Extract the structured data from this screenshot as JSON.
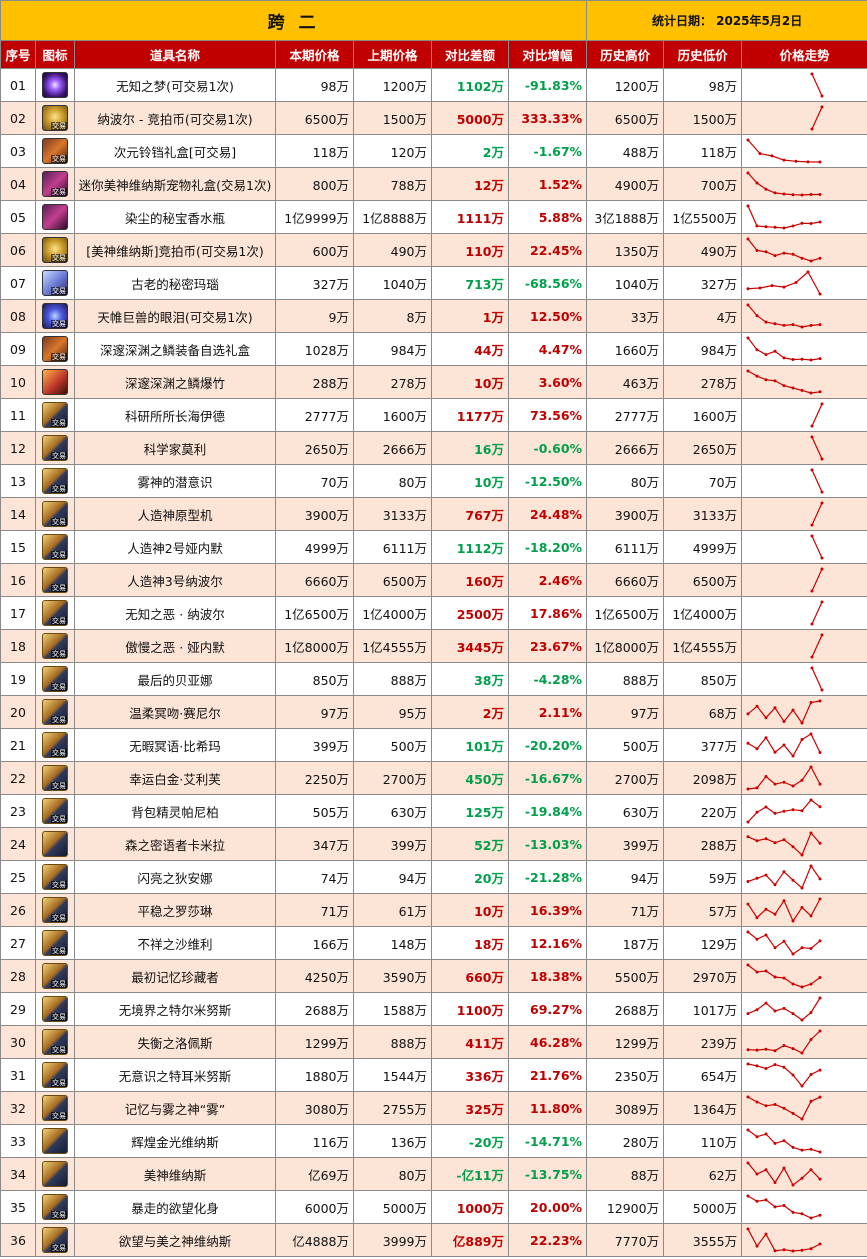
{
  "title": "跨  二",
  "stat_date": "统计日期：  2025年5月2日",
  "columns": {
    "idx": "序号",
    "icon": "图标",
    "name": "道具名称",
    "cur": "本期价格",
    "prev": "上期价格",
    "diff": "对比差额",
    "pct": "对比增幅",
    "high": "历史高价",
    "low": "历史低价",
    "trend": "价格走势"
  },
  "colors": {
    "title_bg": "#ffc000",
    "header_bg": "#c00000",
    "even_row": "#fce4d6",
    "up": "#c00000",
    "down": "#00a04a",
    "trend_line": "#cc0000"
  },
  "rows": [
    {
      "idx": "01",
      "icon": "orb",
      "trade": false,
      "name": "无知之梦(可交易1次)",
      "cur": "98万",
      "prev": "1200万",
      "diff": "1102万",
      "pct": "-91.83%",
      "dir": "down",
      "high": "1200万",
      "low": "98万",
      "trend": [
        1200,
        98
      ]
    },
    {
      "idx": "02",
      "icon": "coin",
      "trade": true,
      "name": "纳波尔 - 竞拍币(可交易1次)",
      "cur": "6500万",
      "prev": "1500万",
      "diff": "5000万",
      "pct": "333.33%",
      "dir": "up",
      "high": "6500万",
      "low": "1500万",
      "trend": [
        1500,
        6500
      ]
    },
    {
      "idx": "03",
      "icon": "box",
      "trade": true,
      "name": "次元铃铛礼盒[可交易]",
      "cur": "118万",
      "prev": "120万",
      "diff": "2万",
      "pct": "-1.67%",
      "dir": "down",
      "high": "488万",
      "low": "118万",
      "trend": [
        488,
        260,
        220,
        150,
        130,
        120,
        118
      ]
    },
    {
      "idx": "04",
      "icon": "bag",
      "trade": true,
      "name": "迷你美神维纳斯宠物礼盒(交易1次)",
      "cur": "800万",
      "prev": "788万",
      "diff": "12万",
      "pct": "1.52%",
      "dir": "up",
      "high": "4900万",
      "low": "700万",
      "trend": [
        4900,
        3000,
        1800,
        1100,
        900,
        760,
        700,
        788,
        800
      ]
    },
    {
      "idx": "05",
      "icon": "bag",
      "trade": false,
      "name": "染尘的秘宝香水瓶",
      "cur": "1亿9999万",
      "prev": "1亿8888万",
      "diff": "1111万",
      "pct": "5.88%",
      "dir": "up",
      "high": "3亿1888万",
      "low": "1亿5500万",
      "trend": [
        31888,
        17000,
        16500,
        16000,
        15500,
        17000,
        19000,
        18888,
        19999
      ]
    },
    {
      "idx": "06",
      "icon": "coin",
      "trade": true,
      "name": "[美神维纳斯]竞拍币(可交易1次)",
      "cur": "600万",
      "prev": "490万",
      "diff": "110万",
      "pct": "22.45%",
      "dir": "up",
      "high": "1350万",
      "low": "490万",
      "trend": [
        1350,
        900,
        850,
        700,
        800,
        750,
        600,
        490,
        600
      ]
    },
    {
      "idx": "07",
      "icon": "crystal",
      "trade": true,
      "name": "古老的秘密玛瑙",
      "cur": "327万",
      "prev": "1040万",
      "diff": "713万",
      "pct": "-68.56%",
      "dir": "down",
      "high": "1040万",
      "low": "327万",
      "trend": [
        500,
        520,
        600,
        550,
        700,
        1040,
        327
      ]
    },
    {
      "idx": "08",
      "icon": "eye",
      "trade": true,
      "name": "天帷巨兽的眼泪(可交易1次)",
      "cur": "9万",
      "prev": "8万",
      "diff": "1万",
      "pct": "12.50%",
      "dir": "up",
      "high": "33万",
      "low": "4万",
      "trend": [
        33,
        20,
        12,
        10,
        8,
        9,
        6,
        8,
        9
      ]
    },
    {
      "idx": "09",
      "icon": "box",
      "trade": true,
      "name": "深邃深渊之鳞装备自选礼盒",
      "cur": "1028万",
      "prev": "984万",
      "diff": "44万",
      "pct": "4.47%",
      "dir": "up",
      "high": "1660万",
      "low": "984万",
      "trend": [
        1660,
        1300,
        1150,
        1250,
        1050,
        1000,
        1010,
        984,
        1028
      ]
    },
    {
      "idx": "10",
      "icon": "fire",
      "trade": false,
      "name": "深邃深渊之鳞爆竹",
      "cur": "288万",
      "prev": "278万",
      "diff": "10万",
      "pct": "3.60%",
      "dir": "up",
      "high": "463万",
      "low": "278万",
      "trend": [
        463,
        420,
        390,
        380,
        340,
        320,
        300,
        278,
        288
      ]
    },
    {
      "idx": "11",
      "icon": "card",
      "trade": true,
      "name": "科研所所长海伊德",
      "cur": "2777万",
      "prev": "1600万",
      "diff": "1177万",
      "pct": "73.56%",
      "dir": "up",
      "high": "2777万",
      "low": "1600万",
      "trend": [
        1600,
        2777
      ]
    },
    {
      "idx": "12",
      "icon": "card",
      "trade": true,
      "name": "科学家莫利",
      "cur": "2650万",
      "prev": "2666万",
      "diff": "16万",
      "pct": "-0.60%",
      "dir": "down",
      "high": "2666万",
      "low": "2650万",
      "trend": [
        2666,
        2650
      ]
    },
    {
      "idx": "13",
      "icon": "card",
      "trade": true,
      "name": "雾神的潜意识",
      "cur": "70万",
      "prev": "80万",
      "diff": "10万",
      "pct": "-12.50%",
      "dir": "down",
      "high": "80万",
      "low": "70万",
      "trend": [
        80,
        70
      ]
    },
    {
      "idx": "14",
      "icon": "card",
      "trade": true,
      "name": "人造神原型机",
      "cur": "3900万",
      "prev": "3133万",
      "diff": "767万",
      "pct": "24.48%",
      "dir": "up",
      "high": "3900万",
      "low": "3133万",
      "trend": [
        3133,
        3900
      ]
    },
    {
      "idx": "15",
      "icon": "card",
      "trade": true,
      "name": "人造神2号娅内默",
      "cur": "4999万",
      "prev": "6111万",
      "diff": "1112万",
      "pct": "-18.20%",
      "dir": "down",
      "high": "6111万",
      "low": "4999万",
      "trend": [
        6111,
        4999
      ]
    },
    {
      "idx": "16",
      "icon": "card",
      "trade": true,
      "name": "人造神3号纳波尔",
      "cur": "6660万",
      "prev": "6500万",
      "diff": "160万",
      "pct": "2.46%",
      "dir": "up",
      "high": "6660万",
      "low": "6500万",
      "trend": [
        6500,
        6660
      ]
    },
    {
      "idx": "17",
      "icon": "card",
      "trade": true,
      "name": "无知之恶 · 纳波尔",
      "cur": "1亿6500万",
      "prev": "1亿4000万",
      "diff": "2500万",
      "pct": "17.86%",
      "dir": "up",
      "high": "1亿6500万",
      "low": "1亿4000万",
      "trend": [
        14000,
        16500
      ]
    },
    {
      "idx": "18",
      "icon": "card",
      "trade": true,
      "name": "傲慢之恶 · 娅内默",
      "cur": "1亿8000万",
      "prev": "1亿4555万",
      "diff": "3445万",
      "pct": "23.67%",
      "dir": "up",
      "high": "1亿8000万",
      "low": "1亿4555万",
      "trend": [
        14555,
        18000
      ]
    },
    {
      "idx": "19",
      "icon": "card",
      "trade": true,
      "name": "最后的贝亚娜",
      "cur": "850万",
      "prev": "888万",
      "diff": "38万",
      "pct": "-4.28%",
      "dir": "down",
      "high": "888万",
      "low": "850万",
      "trend": [
        888,
        850
      ]
    },
    {
      "idx": "20",
      "icon": "card",
      "trade": true,
      "name": "温柔冥吻·赛尼尔",
      "cur": "97万",
      "prev": "95万",
      "diff": "2万",
      "pct": "2.11%",
      "dir": "up",
      "high": "97万",
      "low": "68万",
      "trend": [
        80,
        90,
        75,
        88,
        70,
        85,
        68,
        95,
        97
      ]
    },
    {
      "idx": "21",
      "icon": "card",
      "trade": true,
      "name": "无暇冥语·比希玛",
      "cur": "399万",
      "prev": "500万",
      "diff": "101万",
      "pct": "-20.20%",
      "dir": "down",
      "high": "500万",
      "low": "377万",
      "trend": [
        450,
        420,
        480,
        400,
        440,
        380,
        470,
        500,
        399
      ]
    },
    {
      "idx": "22",
      "icon": "card",
      "trade": true,
      "name": "幸运白金·艾利芙",
      "cur": "2250万",
      "prev": "2700万",
      "diff": "450万",
      "pct": "-16.67%",
      "dir": "down",
      "high": "2700万",
      "low": "2098万",
      "trend": [
        2120,
        2150,
        2450,
        2250,
        2300,
        2200,
        2350,
        2700,
        2250
      ]
    },
    {
      "idx": "23",
      "icon": "card",
      "trade": true,
      "name": "背包精灵帕尼柏",
      "cur": "505万",
      "prev": "630万",
      "diff": "125万",
      "pct": "-19.84%",
      "dir": "down",
      "high": "630万",
      "low": "220万",
      "trend": [
        220,
        400,
        500,
        380,
        420,
        450,
        430,
        630,
        505
      ]
    },
    {
      "idx": "24",
      "icon": "card",
      "trade": false,
      "name": "森之密语者卡米拉",
      "cur": "347万",
      "prev": "399万",
      "diff": "52万",
      "pct": "-13.03%",
      "dir": "down",
      "high": "399万",
      "low": "288万",
      "trend": [
        380,
        360,
        370,
        350,
        365,
        330,
        288,
        399,
        347
      ]
    },
    {
      "idx": "25",
      "icon": "card",
      "trade": true,
      "name": "闪亮之狄安娜",
      "cur": "74万",
      "prev": "94万",
      "diff": "20万",
      "pct": "-21.28%",
      "dir": "down",
      "high": "94万",
      "low": "59万",
      "trend": [
        70,
        75,
        80,
        65,
        85,
        72,
        60,
        94,
        74
      ]
    },
    {
      "idx": "26",
      "icon": "card",
      "trade": true,
      "name": "平稳之罗莎琳",
      "cur": "71万",
      "prev": "61万",
      "diff": "10万",
      "pct": "16.39%",
      "dir": "up",
      "high": "71万",
      "low": "57万",
      "trend": [
        68,
        60,
        65,
        62,
        70,
        58,
        66,
        61,
        71
      ]
    },
    {
      "idx": "27",
      "icon": "card",
      "trade": true,
      "name": "不祥之沙维利",
      "cur": "166万",
      "prev": "148万",
      "diff": "18万",
      "pct": "12.16%",
      "dir": "up",
      "high": "187万",
      "low": "129万",
      "trend": [
        187,
        170,
        180,
        150,
        165,
        135,
        150,
        148,
        166
      ]
    },
    {
      "idx": "28",
      "icon": "card",
      "trade": true,
      "name": "最初记忆珍藏者",
      "cur": "4250万",
      "prev": "3590万",
      "diff": "660万",
      "pct": "18.38%",
      "dir": "up",
      "high": "5500万",
      "low": "2970万",
      "trend": [
        5500,
        4800,
        4900,
        4300,
        4200,
        3600,
        3300,
        3590,
        4250
      ]
    },
    {
      "idx": "29",
      "icon": "card",
      "trade": true,
      "name": "无境界之特尔米努斯",
      "cur": "2688万",
      "prev": "1588万",
      "diff": "1100万",
      "pct": "69.27%",
      "dir": "up",
      "high": "2688万",
      "low": "1017万",
      "trend": [
        1500,
        1800,
        2300,
        1700,
        1900,
        1500,
        1017,
        1588,
        2688
      ]
    },
    {
      "idx": "30",
      "icon": "card",
      "trade": true,
      "name": "失衡之洛佩斯",
      "cur": "1299万",
      "prev": "888万",
      "diff": "411万",
      "pct": "46.28%",
      "dir": "up",
      "high": "1299万",
      "low": "239万",
      "trend": [
        400,
        380,
        420,
        350,
        600,
        450,
        239,
        888,
        1299
      ]
    },
    {
      "idx": "31",
      "icon": "card",
      "trade": true,
      "name": "无意识之特耳米努斯",
      "cur": "1880万",
      "prev": "1544万",
      "diff": "336万",
      "pct": "21.76%",
      "dir": "up",
      "high": "2350万",
      "low": "654万",
      "trend": [
        2350,
        2200,
        2000,
        2300,
        2100,
        1500,
        654,
        1544,
        1880
      ]
    },
    {
      "idx": "32",
      "icon": "card",
      "trade": true,
      "name": "记忆与雾之神“雾”",
      "cur": "3080万",
      "prev": "2755万",
      "diff": "325万",
      "pct": "11.80%",
      "dir": "up",
      "high": "3089万",
      "low": "1364万",
      "trend": [
        3089,
        2700,
        2400,
        2500,
        2200,
        1800,
        1364,
        2755,
        3080
      ]
    },
    {
      "idx": "33",
      "icon": "card",
      "trade": false,
      "name": "辉煌金光维纳斯",
      "cur": "116万",
      "prev": "136万",
      "diff": "-20万",
      "pct": "-14.71%",
      "dir": "down",
      "high": "280万",
      "low": "110万",
      "trend": [
        280,
        230,
        250,
        180,
        200,
        150,
        130,
        136,
        116
      ]
    },
    {
      "idx": "34",
      "icon": "card",
      "trade": false,
      "name": "美神维纳斯",
      "cur": "亿69万",
      "prev": "80万",
      "diff": "-亿11万",
      "pct": "-13.75%",
      "dir": "down",
      "high": "88万",
      "low": "62万",
      "trend": [
        88,
        75,
        80,
        65,
        82,
        62,
        70,
        80,
        69
      ]
    },
    {
      "idx": "35",
      "icon": "card",
      "trade": true,
      "name": "暴走的欲望化身",
      "cur": "6000万",
      "prev": "5000万",
      "diff": "1000万",
      "pct": "20.00%",
      "dir": "up",
      "high": "12900万",
      "low": "5000万",
      "trend": [
        12900,
        11000,
        11500,
        9000,
        9500,
        7000,
        6500,
        5000,
        6000
      ]
    },
    {
      "idx": "36",
      "icon": "card",
      "trade": true,
      "name": "欲望与美之神维纳斯",
      "cur": "亿4888万",
      "prev": "3999万",
      "diff": "亿889万",
      "pct": "22.23%",
      "dir": "up",
      "high": "7770万",
      "low": "3555万",
      "trend": [
        7770,
        4500,
        6800,
        3600,
        3800,
        3555,
        3700,
        3999,
        4888
      ]
    }
  ]
}
